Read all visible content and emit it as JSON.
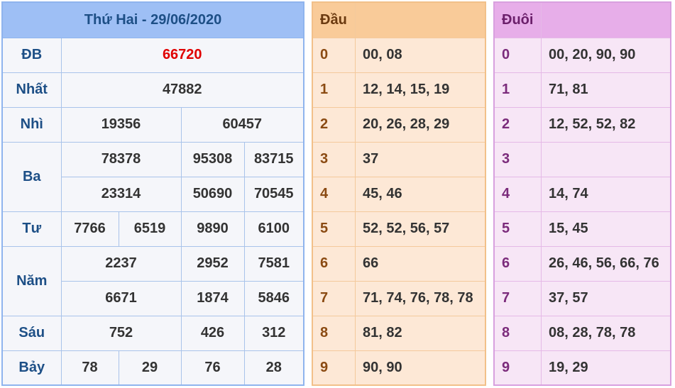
{
  "results": {
    "title": "Thứ Hai - 29/06/2020",
    "labels": {
      "db": "ĐB",
      "nhat": "Nhất",
      "nhi": "Nhì",
      "ba": "Ba",
      "tu": "Tư",
      "nam": "Năm",
      "sau": "Sáu",
      "bay": "Bảy"
    },
    "db": [
      "66720"
    ],
    "nhat": [
      "47882"
    ],
    "nhi": [
      "19356",
      "60457"
    ],
    "ba": [
      "78378",
      "95308",
      "83715",
      "23314",
      "50690",
      "70545"
    ],
    "tu": [
      "7766",
      "6519",
      "9890",
      "6100"
    ],
    "nam": [
      "2237",
      "2952",
      "7581",
      "6671",
      "1874",
      "5846"
    ],
    "sau": [
      "752",
      "426",
      "312"
    ],
    "bay": [
      "78",
      "29",
      "76",
      "28"
    ]
  },
  "dau": {
    "header": "Đầu",
    "rows": [
      {
        "digit": "0",
        "values": "00, 08"
      },
      {
        "digit": "1",
        "values": "12, 14, 15, 19"
      },
      {
        "digit": "2",
        "values": "20, 26, 28, 29"
      },
      {
        "digit": "3",
        "values": "37"
      },
      {
        "digit": "4",
        "values": "45, 46"
      },
      {
        "digit": "5",
        "values": "52, 52, 56, 57"
      },
      {
        "digit": "6",
        "values": "66"
      },
      {
        "digit": "7",
        "values": "71, 74, 76, 78, 78"
      },
      {
        "digit": "8",
        "values": "81, 82"
      },
      {
        "digit": "9",
        "values": "90, 90"
      }
    ]
  },
  "duoi": {
    "header": "Đuôi",
    "rows": [
      {
        "digit": "0",
        "values": "00, 20, 90, 90"
      },
      {
        "digit": "1",
        "values": "71, 81"
      },
      {
        "digit": "2",
        "values": "12, 52, 52, 82"
      },
      {
        "digit": "3",
        "values": ""
      },
      {
        "digit": "4",
        "values": "14, 74"
      },
      {
        "digit": "5",
        "values": "15, 45"
      },
      {
        "digit": "6",
        "values": "26, 46, 56, 66, 76"
      },
      {
        "digit": "7",
        "values": "37, 57"
      },
      {
        "digit": "8",
        "values": "08, 28, 78, 78"
      },
      {
        "digit": "9",
        "values": "19, 29"
      }
    ]
  }
}
